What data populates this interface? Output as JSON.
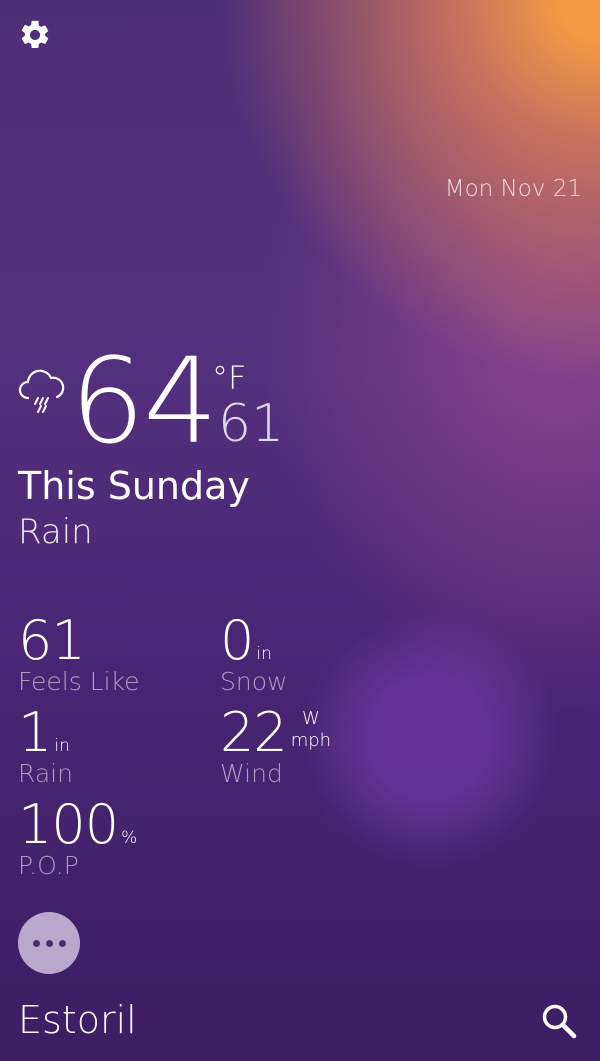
{
  "header": {
    "settings_icon": "gear-icon",
    "date": "Mon Nov 21"
  },
  "current": {
    "icon": "rain-cloud-icon",
    "temp": "64",
    "unit": "°F",
    "low": "61",
    "day": "This Sunday",
    "condition": "Rain"
  },
  "stats": {
    "feels_like": {
      "value": "61",
      "label": "Feels Like"
    },
    "snow": {
      "value": "0",
      "unit": "in",
      "label": "Snow"
    },
    "rain": {
      "value": "1",
      "unit": "in",
      "label": "Rain"
    },
    "wind": {
      "value": "22",
      "direction": "W",
      "unit": "mph",
      "label": "Wind"
    },
    "pop": {
      "value": "100",
      "unit": "%",
      "label": "P.O.P"
    }
  },
  "footer": {
    "more_icon": "more-icon",
    "location": "Estoril",
    "search_icon": "search-icon"
  }
}
